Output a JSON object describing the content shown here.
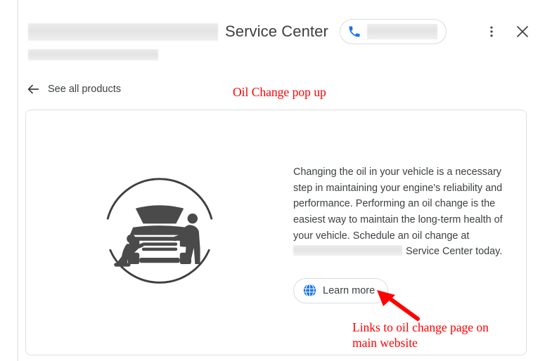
{
  "header": {
    "business_name": "",
    "business_name_redacted": true,
    "title": "Service Center",
    "subtitle_redacted": true,
    "phone_number": "",
    "phone_number_redacted": true,
    "phone_icon": "phone-icon",
    "menu_icon": "overflow-menu-icon",
    "close_icon": "close-icon"
  },
  "nav": {
    "back_icon": "back-arrow-icon",
    "see_all_products_label": "See all products"
  },
  "card": {
    "illustration_name": "car-service-mechanics-illustration",
    "description_part1": "Changing the oil in your vehicle is a necessary step in maintaining your engine's reliability and performance. Performing an oil change is the easiest way to maintain the long-term health of your vehicle. Schedule an oil change at ",
    "description_business_redacted": true,
    "description_part2": " Service Center today.",
    "learn_more_label": "Learn more",
    "learn_more_icon": "globe-icon"
  },
  "annotations": {
    "title_note": "Oil Change pop up",
    "learn_more_note": "Links to oil change page on main website",
    "arrow_name": "red-arrow-pointing-to-learn-more",
    "color": "#ff0000"
  },
  "colors": {
    "text_primary": "#3c4043",
    "accent_blue": "#1a73e8",
    "border": "#dadce0",
    "card_border": "#e0e0e0",
    "annotation_red": "#ff0000"
  }
}
